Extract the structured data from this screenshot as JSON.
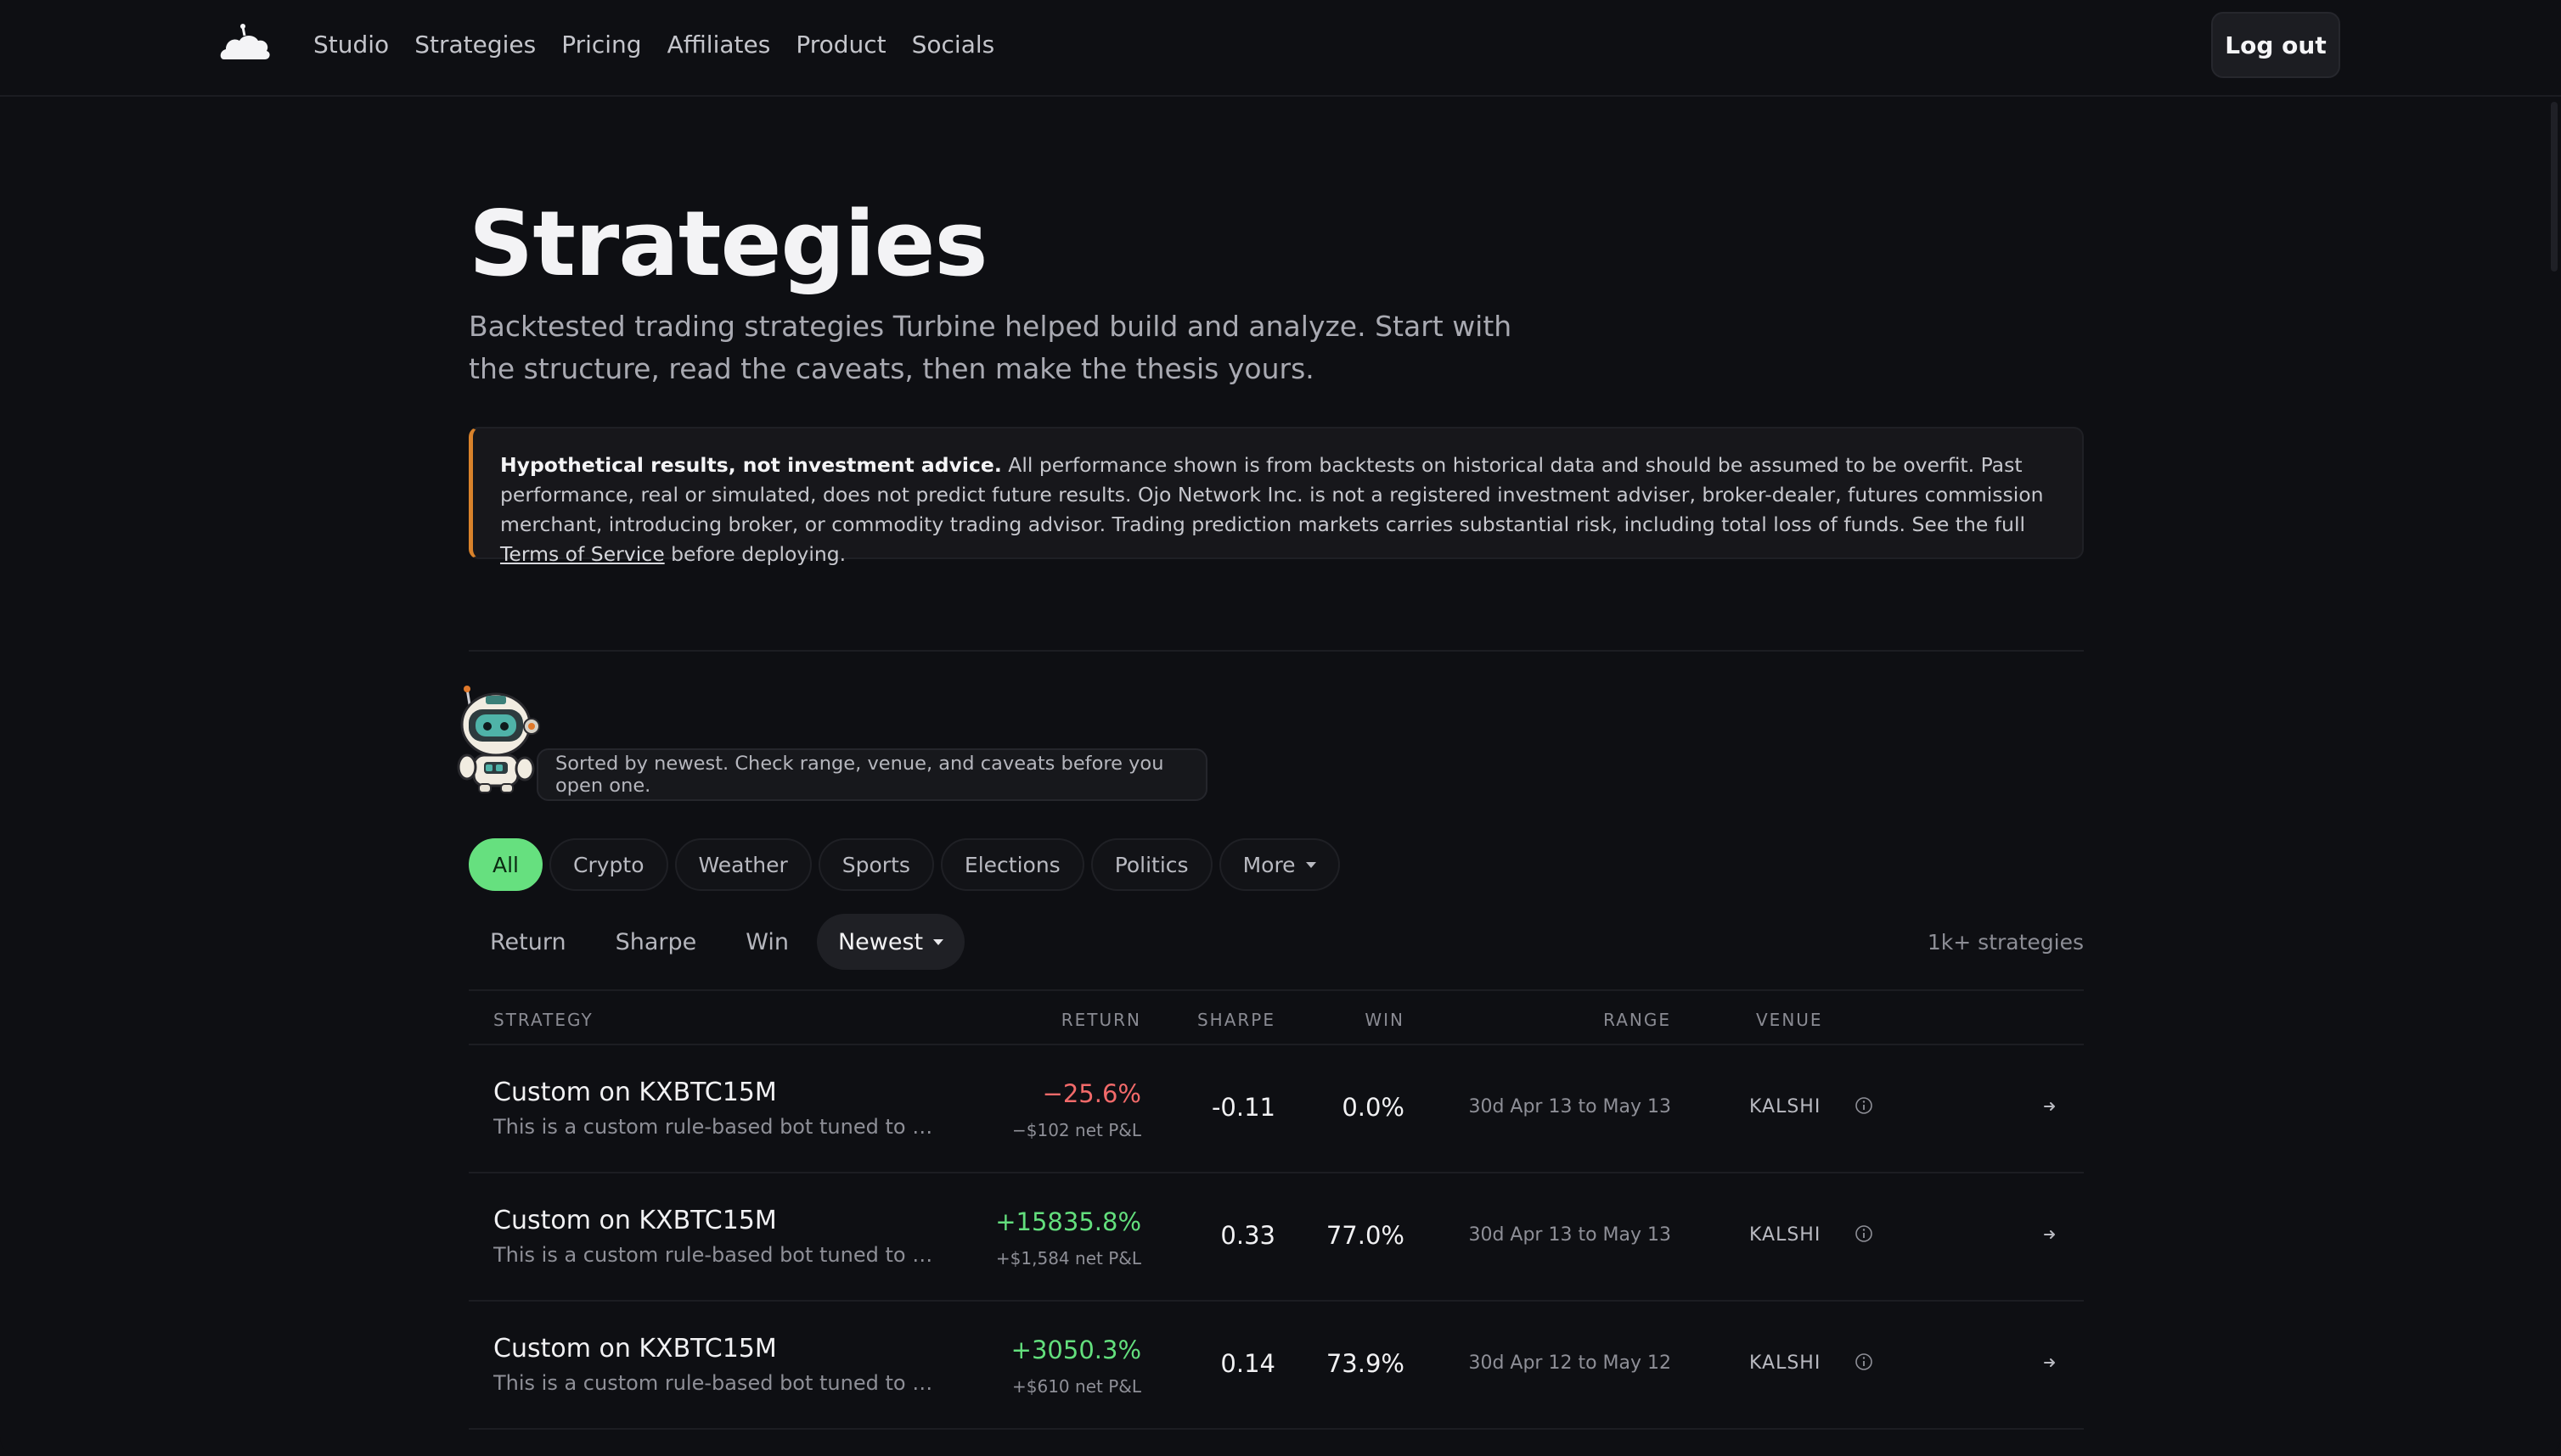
{
  "nav": {
    "links": [
      "Studio",
      "Strategies",
      "Pricing",
      "Affiliates",
      "Product",
      "Socials"
    ],
    "logout_label": "Log out"
  },
  "page": {
    "title": "Strategies",
    "subtitle": "Backtested trading strategies Turbine helped build and analyze. Start with the structure, read the caveats, then make the thesis yours."
  },
  "disclaimer": {
    "heading": "Hypothetical results, not investment advice.",
    "body": " All performance shown is from backtests on historical data and should be assumed to be overfit. Past performance, real or simulated, does not predict future results. Ojo Network Inc. is not a registered investment adviser, broker-dealer, futures commission merchant, introducing broker, or commodity trading advisor. Trading prediction markets carries substantial risk, including total loss of funds. See the full ",
    "tos_link": "Terms of Service",
    "tail": " before deploying."
  },
  "tip": "Sorted by newest. Check range, venue, and caveats before you open one.",
  "filters": [
    {
      "label": "All",
      "active": true
    },
    {
      "label": "Crypto"
    },
    {
      "label": "Weather"
    },
    {
      "label": "Sports"
    },
    {
      "label": "Elections"
    },
    {
      "label": "Politics"
    },
    {
      "label": "More",
      "dropdown": true
    }
  ],
  "sorts": [
    {
      "label": "Return"
    },
    {
      "label": "Sharpe"
    },
    {
      "label": "Win"
    },
    {
      "label": "Newest",
      "active": true,
      "dropdown": true
    }
  ],
  "count_label": "1k+ strategies",
  "table": {
    "headers": {
      "strategy": "STRATEGY",
      "return": "RETURN",
      "sharpe": "SHARPE",
      "win": "WIN",
      "range": "RANGE",
      "venue": "VENUE"
    },
    "rows": [
      {
        "name": "Custom on KXBTC15M",
        "desc": "This is a custom rule-based bot tuned to spe…",
        "return": "−25.6%",
        "return_sign": "neg",
        "pnl": "−$102 net P&L",
        "sharpe": "-0.11",
        "win": "0.0%",
        "range": "30d Apr 13 to May 13",
        "venue": "KALSHI"
      },
      {
        "name": "Custom on KXBTC15M",
        "desc": "This is a custom rule-based bot tuned to spe…",
        "return": "+15835.8%",
        "return_sign": "pos",
        "pnl": "+$1,584 net P&L",
        "sharpe": "0.33",
        "win": "77.0%",
        "range": "30d Apr 13 to May 13",
        "venue": "KALSHI"
      },
      {
        "name": "Custom on KXBTC15M",
        "desc": "This is a custom rule-based bot tuned to spe…",
        "return": "+3050.3%",
        "return_sign": "pos",
        "pnl": "+$610 net P&L",
        "sharpe": "0.14",
        "win": "73.9%",
        "range": "30d Apr 12 to May 12",
        "venue": "KALSHI"
      }
    ]
  },
  "colors": {
    "accent_green": "#66e07f",
    "negative_red": "#f26a6a",
    "warning_orange": "#d9822b",
    "background": "#0e0f13"
  }
}
